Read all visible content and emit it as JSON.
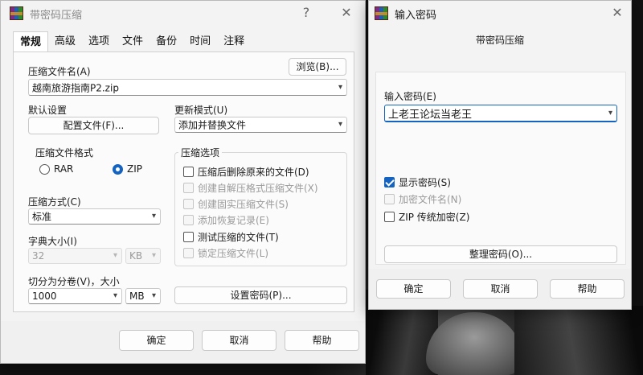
{
  "left_dialog": {
    "title": "带密码压缩",
    "help_glyph": "?",
    "close_glyph": "✕",
    "tabs": [
      "常规",
      "高级",
      "选项",
      "文件",
      "备份",
      "时间",
      "注释"
    ],
    "archive_name_label": "压缩文件名(A)",
    "browse_label": "浏览(B)...",
    "archive_name_value": "越南旅游指南P2.zip",
    "default_settings_label": "默认设置",
    "profiles_label": "配置文件(F)...",
    "update_mode_label": "更新模式(U)",
    "update_mode_value": "添加并替换文件",
    "format_group_label": "压缩文件格式",
    "format_options": [
      "RAR",
      "ZIP"
    ],
    "format_selected": "ZIP",
    "compression_method_label": "压缩方式(C)",
    "compression_method_value": "标准",
    "dict_size_label": "字典大小(I)",
    "dict_size_value": "32",
    "dict_unit_value": "KB",
    "split_label": "切分为分卷(V)，大小",
    "split_value": "1000",
    "split_unit_value": "MB",
    "set_password_label": "设置密码(P)...",
    "options_group_label": "压缩选项",
    "options": [
      {
        "label": "压缩后删除原来的文件(D)",
        "enabled": true,
        "checked": false
      },
      {
        "label": "创建自解压格式压缩文件(X)",
        "enabled": false,
        "checked": false
      },
      {
        "label": "创建固实压缩文件(S)",
        "enabled": false,
        "checked": false
      },
      {
        "label": "添加恢复记录(E)",
        "enabled": false,
        "checked": false
      },
      {
        "label": "测试压缩的文件(T)",
        "enabled": true,
        "checked": false
      },
      {
        "label": "锁定压缩文件(L)",
        "enabled": false,
        "checked": false
      }
    ],
    "ok_label": "确定",
    "cancel_label": "取消",
    "help_label": "帮助"
  },
  "right_dialog": {
    "title": "输入密码",
    "close_glyph": "✕",
    "subtitle": "带密码压缩",
    "enter_password_label": "输入密码(E)",
    "password_value": "上老王论坛当老王",
    "options": [
      {
        "label": "显示密码(S)",
        "enabled": true,
        "checked": true
      },
      {
        "label": "加密文件名(N)",
        "enabled": false,
        "checked": false
      },
      {
        "label": "ZIP 传统加密(Z)",
        "enabled": true,
        "checked": false
      }
    ],
    "organize_label": "整理密码(O)...",
    "ok_label": "确定",
    "cancel_label": "取消",
    "help_label": "帮助"
  },
  "colors": {
    "accent": "#1463c0",
    "dialog_bg": "#f3f3f3",
    "disabled_text": "#9a9a9a"
  }
}
